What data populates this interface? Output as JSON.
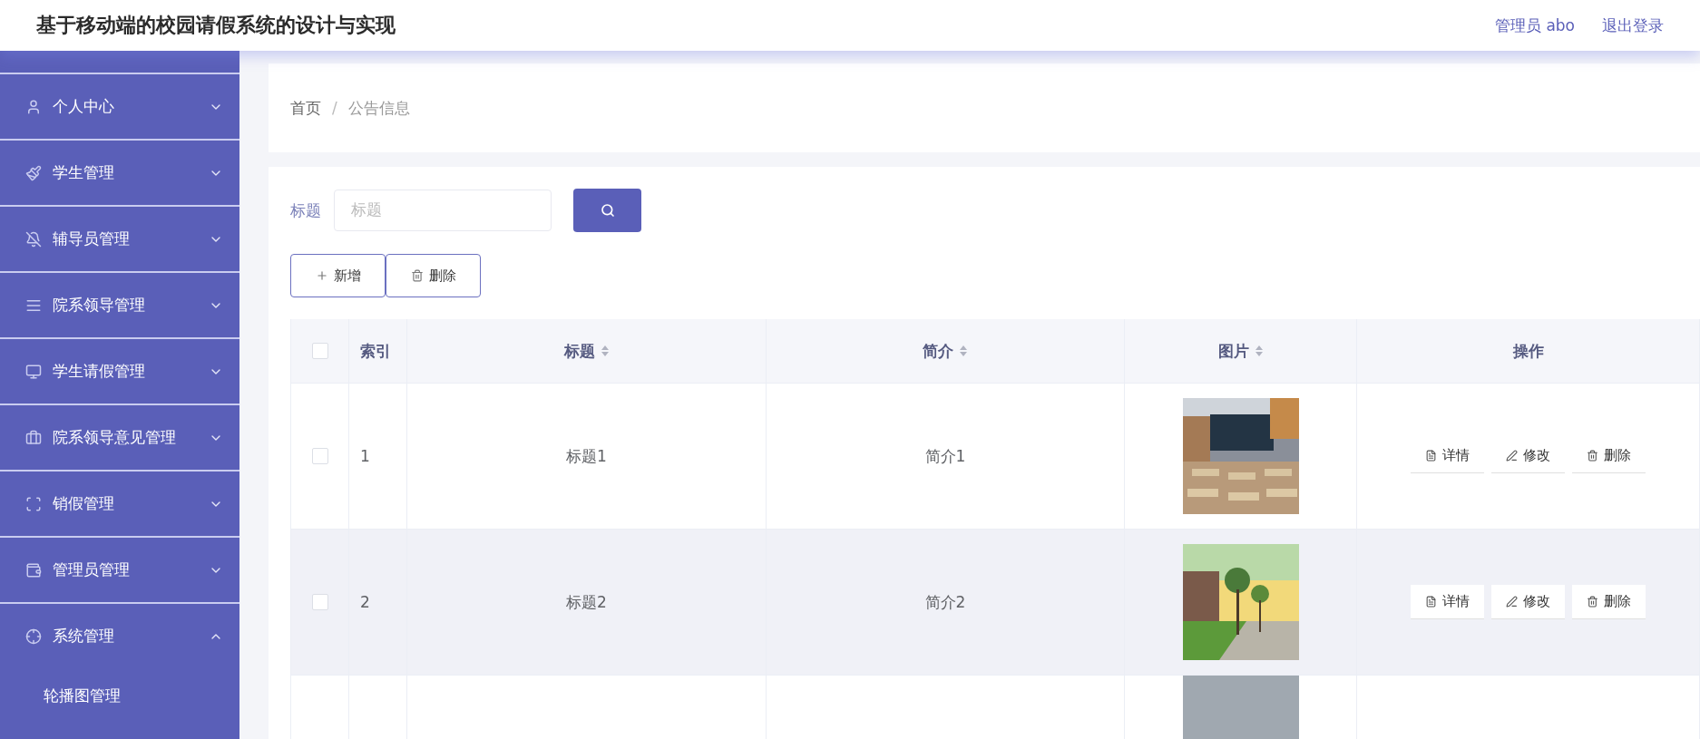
{
  "header": {
    "title": "基于移动端的校园请假系统的设计与实现",
    "user": "管理员 abo",
    "logout": "退出登录"
  },
  "sidebar": {
    "items": [
      {
        "label": "个人中心",
        "expanded": false
      },
      {
        "label": "学生管理",
        "expanded": false
      },
      {
        "label": "辅导员管理",
        "expanded": false
      },
      {
        "label": "院系领导管理",
        "expanded": false
      },
      {
        "label": "学生请假管理",
        "expanded": false
      },
      {
        "label": "院系领导意见管理",
        "expanded": false
      },
      {
        "label": "销假管理",
        "expanded": false
      },
      {
        "label": "管理员管理",
        "expanded": false
      },
      {
        "label": "系统管理",
        "expanded": true,
        "children": [
          {
            "label": "轮播图管理"
          }
        ]
      }
    ]
  },
  "breadcrumb": {
    "items": [
      "首页",
      "公告信息"
    ],
    "separator": "/"
  },
  "search": {
    "label": "标题",
    "placeholder": "标题"
  },
  "actions": [
    "新增",
    "删除"
  ],
  "table": {
    "select_all": {
      "checked": false
    },
    "columns": [
      {
        "label": "索引",
        "sortable": false
      },
      {
        "label": "标题",
        "sortable": true
      },
      {
        "label": "简介",
        "sortable": true
      },
      {
        "label": "图片",
        "sortable": true
      },
      {
        "label": "操作",
        "sortable": false
      }
    ],
    "rows": [
      {
        "checked": false,
        "highlighted": false,
        "index": "1",
        "title": "标题1",
        "intro": "简介1",
        "image": {
          "kind": "picture"
        },
        "buttons": [
          "详情",
          "修改",
          "删除"
        ]
      },
      {
        "checked": false,
        "highlighted": true,
        "index": "2",
        "title": "标题2",
        "intro": "简介2",
        "image": {
          "kind": "picture"
        },
        "buttons": [
          "详情",
          "修改",
          "删除"
        ]
      },
      {
        "image": {
          "kind": "picture"
        }
      }
    ]
  }
}
